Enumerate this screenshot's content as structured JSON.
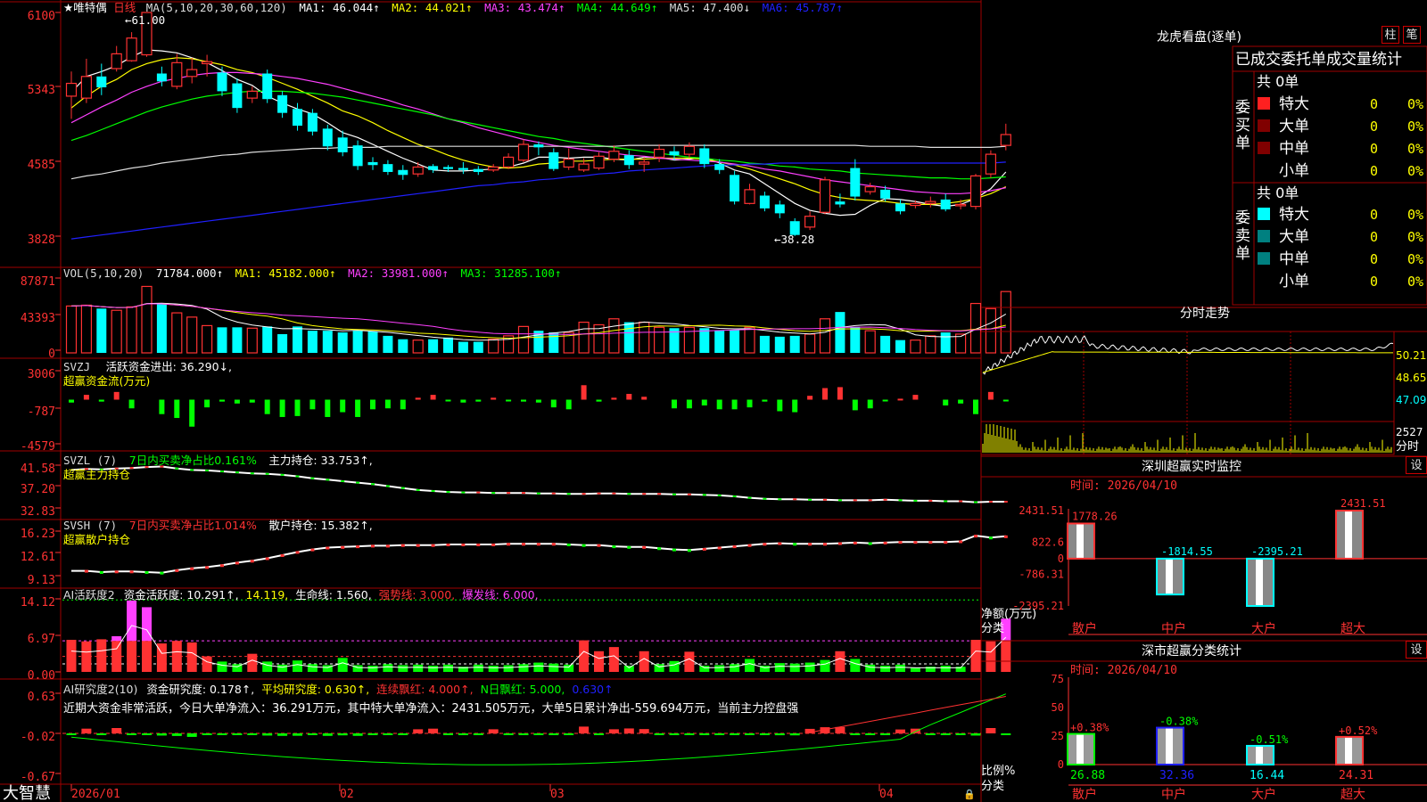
{
  "app": {
    "brand": "大智慧",
    "stock_title": "★唯特偶",
    "period": "日线"
  },
  "colors": {
    "up": "#ff3232",
    "down": "#00ffff",
    "green": "#00ff00",
    "grid": "#a00000",
    "yellow": "#ffff00",
    "magenta": "#ff40ff",
    "white": "#ffffff",
    "blue": "#2020ff"
  },
  "kline": {
    "axis_ticks": [
      "6100",
      "5343",
      "4585",
      "3828"
    ],
    "legend": {
      "ma": "MA(5,10,20,30,60,120)",
      "ma1": "MA1: 46.044↑",
      "ma2": "MA2: 44.021↑",
      "ma3": "MA3: 43.474↑",
      "ma4": "MA4: 44.649↑",
      "ma5": "MA5: 47.400↓",
      "ma6": "MA6: 45.787↑"
    },
    "high_label": "61.00",
    "low_label": "38.28",
    "candles": [
      [
        52.5,
        53.8,
        50.2,
        55.0
      ],
      [
        52.3,
        54.5,
        51.8,
        56.3
      ],
      [
        54.5,
        53.4,
        52.6,
        55.8
      ],
      [
        55.3,
        56.8,
        55.0,
        57.6
      ],
      [
        56.1,
        58.4,
        56.0,
        59.0
      ],
      [
        56.7,
        61.0,
        56.5,
        61.0
      ],
      [
        54.8,
        54.0,
        53.5,
        55.5
      ],
      [
        53.5,
        55.9,
        53.2,
        56.8
      ],
      [
        54.5,
        55.2,
        53.8,
        56.4
      ],
      [
        55.8,
        56.0,
        54.5,
        56.7
      ],
      [
        54.9,
        53.0,
        52.5,
        55.5
      ],
      [
        53.8,
        51.3,
        50.8,
        54.3
      ],
      [
        52.3,
        53.0,
        51.8,
        53.5
      ],
      [
        54.8,
        52.2,
        51.8,
        55.2
      ],
      [
        52.6,
        50.8,
        50.3,
        53.0
      ],
      [
        51.2,
        49.5,
        49.0,
        51.8
      ],
      [
        50.8,
        48.9,
        48.5,
        51.2
      ],
      [
        49.2,
        47.4,
        47.0,
        49.6
      ],
      [
        48.3,
        46.8,
        46.4,
        49.0
      ],
      [
        47.5,
        45.4,
        45.0,
        48.0
      ],
      [
        45.8,
        45.5,
        45.0,
        46.3
      ],
      [
        45.6,
        44.8,
        44.5,
        46.0
      ],
      [
        45.0,
        44.5,
        44.0,
        45.5
      ],
      [
        44.6,
        45.3,
        44.3,
        45.8
      ],
      [
        45.4,
        45.0,
        44.7,
        45.6
      ],
      [
        45.3,
        45.1,
        44.8,
        45.5
      ],
      [
        45.2,
        45.0,
        44.6,
        45.8
      ],
      [
        45.1,
        44.8,
        44.5,
        45.4
      ],
      [
        45.0,
        45.3,
        44.8,
        45.6
      ],
      [
        45.3,
        46.3,
        45.1,
        46.7
      ],
      [
        46.0,
        47.6,
        45.8,
        48.1
      ],
      [
        47.6,
        47.3,
        46.5,
        47.9
      ],
      [
        46.8,
        45.1,
        44.9,
        47.2
      ],
      [
        45.3,
        46.1,
        45.0,
        47.2
      ],
      [
        45.0,
        45.6,
        44.8,
        46.2
      ],
      [
        45.2,
        46.4,
        45.0,
        46.8
      ],
      [
        46.1,
        46.9,
        45.8,
        47.5
      ],
      [
        46.5,
        45.5,
        45.1,
        47.0
      ],
      [
        45.6,
        45.8,
        44.8,
        46.3
      ],
      [
        46.3,
        47.1,
        45.8,
        47.6
      ],
      [
        46.9,
        46.5,
        46.0,
        47.4
      ],
      [
        46.6,
        47.4,
        46.2,
        47.8
      ],
      [
        47.2,
        45.6,
        45.2,
        47.6
      ],
      [
        45.6,
        45.0,
        44.6,
        46.1
      ],
      [
        44.5,
        41.8,
        41.5,
        44.9
      ],
      [
        41.6,
        43.0,
        41.5,
        43.6
      ],
      [
        42.4,
        41.1,
        40.8,
        42.8
      ],
      [
        41.5,
        40.6,
        40.1,
        41.9
      ],
      [
        39.8,
        38.4,
        38.3,
        40.1
      ],
      [
        39.2,
        40.3,
        38.9,
        40.8
      ],
      [
        40.7,
        44.0,
        40.5,
        44.3
      ],
      [
        41.8,
        41.5,
        41.2,
        42.6
      ],
      [
        45.2,
        42.3,
        41.9,
        46.1
      ],
      [
        42.8,
        43.3,
        42.5,
        43.7
      ],
      [
        43.0,
        42.1,
        41.8,
        43.4
      ],
      [
        41.6,
        40.8,
        40.5,
        42.0
      ],
      [
        41.4,
        41.6,
        41.1,
        41.9
      ],
      [
        41.6,
        41.8,
        41.2,
        42.3
      ],
      [
        42.0,
        41.0,
        40.8,
        42.6
      ],
      [
        41.4,
        41.5,
        41.0,
        42.0
      ],
      [
        41.3,
        44.4,
        41.0,
        44.6
      ],
      [
        44.6,
        46.6,
        44.2,
        47.0
      ],
      [
        47.5,
        48.6,
        47.0,
        49.7
      ]
    ],
    "ma_lines": [
      {
        "color": "#ffffff",
        "values": [
          52.9,
          54.5,
          55.0,
          55.6,
          56.5,
          57.2,
          57.1,
          56.9,
          56.4,
          55.9,
          55.1,
          54.2,
          53.6,
          52.5,
          51.8,
          51.2,
          50.7,
          49.8,
          48.8,
          48.3,
          47.6,
          46.9,
          46.2,
          45.6,
          45.0,
          44.9,
          44.9,
          45.0,
          45.1,
          45.3,
          45.7,
          46.3,
          46.3,
          46.2,
          46.3,
          46.3,
          46.1,
          46.0,
          46.3,
          46.3,
          46.0,
          46.1,
          46.3,
          45.7,
          45.0,
          44.6,
          43.6,
          42.6,
          41.6,
          40.9,
          40.6,
          40.4,
          40.5,
          41.4,
          42.1,
          42.0,
          41.8,
          41.5,
          41.3,
          41.5,
          42.1,
          43.1,
          44.8
        ]
      },
      {
        "color": "#ffff00",
        "values": [
          51.3,
          52.5,
          53.5,
          54.2,
          55.2,
          55.8,
          56.2,
          56.4,
          56.3,
          56.0,
          55.7,
          55.2,
          54.9,
          54.4,
          53.8,
          53.2,
          52.5,
          51.8,
          51.0,
          50.5,
          49.8,
          49.0,
          48.3,
          47.6,
          47.1,
          46.5,
          46.0,
          45.6,
          45.3,
          45.2,
          45.3,
          45.6,
          45.7,
          45.9,
          45.9,
          46.0,
          46.1,
          46.1,
          46.1,
          46.2,
          46.2,
          46.2,
          46.1,
          45.8,
          45.5,
          45.1,
          44.6,
          44.1,
          43.6,
          43.0,
          42.5,
          42.2,
          42.0,
          41.9,
          41.8,
          41.6,
          41.5,
          41.5,
          41.6,
          41.8,
          42.1,
          42.6,
          43.3
        ]
      },
      {
        "color": "#ff40ff",
        "values": [
          49.8,
          50.6,
          51.4,
          52.1,
          52.9,
          53.5,
          54.0,
          54.3,
          54.6,
          54.8,
          54.9,
          54.9,
          54.8,
          54.7,
          54.5,
          54.3,
          54.0,
          53.7,
          53.3,
          52.9,
          52.5,
          52.1,
          51.6,
          51.2,
          50.7,
          50.2,
          49.8,
          49.3,
          48.9,
          48.5,
          48.1,
          47.8,
          47.5,
          47.3,
          47.1,
          46.9,
          46.7,
          46.5,
          46.4,
          46.2,
          46.1,
          46.0,
          45.9,
          45.8,
          45.6,
          45.4,
          45.1,
          44.9,
          44.6,
          44.3,
          44.0,
          43.8,
          43.6,
          43.4,
          43.2,
          43.0,
          42.8,
          42.7,
          42.6,
          42.6,
          42.7,
          42.9,
          43.2
        ]
      },
      {
        "color": "#00ff00",
        "values": [
          48.0,
          48.5,
          49.1,
          49.7,
          50.3,
          50.9,
          51.4,
          51.8,
          52.2,
          52.5,
          52.7,
          52.9,
          53.0,
          53.0,
          53.0,
          52.9,
          52.8,
          52.6,
          52.4,
          52.1,
          51.8,
          51.5,
          51.2,
          50.9,
          50.6,
          50.2,
          49.9,
          49.6,
          49.3,
          49.0,
          48.7,
          48.4,
          48.2,
          47.9,
          47.7,
          47.5,
          47.3,
          47.1,
          46.9,
          46.7,
          46.5,
          46.3,
          46.2,
          46.0,
          45.9,
          45.7,
          45.6,
          45.4,
          45.3,
          45.1,
          45.0,
          44.9,
          44.7,
          44.6,
          44.5,
          44.4,
          44.3,
          44.2,
          44.2,
          44.1,
          44.1,
          44.2,
          44.3
        ]
      },
      {
        "color": "#dddddd",
        "values": [
          44.1,
          44.4,
          44.6,
          44.9,
          45.2,
          45.4,
          45.7,
          45.9,
          46.1,
          46.3,
          46.5,
          46.6,
          46.8,
          46.9,
          47.0,
          47.1,
          47.2,
          47.2,
          47.3,
          47.3,
          47.3,
          47.4,
          47.4,
          47.4,
          47.4,
          47.4,
          47.4,
          47.4,
          47.4,
          47.4,
          47.4,
          47.4,
          47.4,
          47.4,
          47.4,
          47.4,
          47.4,
          47.5,
          47.5,
          47.5,
          47.5,
          47.5,
          47.5,
          47.5,
          47.5,
          47.5,
          47.5,
          47.5,
          47.5,
          47.5,
          47.5,
          47.5,
          47.5,
          47.4,
          47.4,
          47.4,
          47.4,
          47.3,
          47.3,
          47.3,
          47.3,
          47.3,
          47.4
        ]
      },
      {
        "color": "#2020ff",
        "values": [
          38.0,
          38.2,
          38.4,
          38.6,
          38.8,
          39.0,
          39.2,
          39.4,
          39.6,
          39.8,
          40.0,
          40.2,
          40.4,
          40.6,
          40.8,
          41.0,
          41.2,
          41.4,
          41.6,
          41.8,
          42.0,
          42.2,
          42.4,
          42.6,
          42.8,
          43.0,
          43.2,
          43.4,
          43.5,
          43.7,
          43.8,
          44.0,
          44.1,
          44.3,
          44.4,
          44.6,
          44.7,
          44.9,
          45.0,
          45.1,
          45.2,
          45.3,
          45.4,
          45.5,
          45.5,
          45.6,
          45.6,
          45.7,
          45.7,
          45.7,
          45.7,
          45.7,
          45.7,
          45.7,
          45.7,
          45.7,
          45.7,
          45.7,
          45.7,
          45.7,
          45.7,
          45.7,
          45.8
        ]
      }
    ]
  },
  "volume": {
    "axis_ticks": [
      "87871",
      "43393",
      "0"
    ],
    "legend": {
      "name": "VOL(5,10,20)",
      "value": "71784.000↑",
      "ma1": "MA1: 45182.000↑",
      "ma2": "MA2: 33981.000↑",
      "ma3": "MA3: 31285.100↑"
    },
    "values": [
      55000,
      56000,
      52000,
      50000,
      54000,
      78000,
      58000,
      47000,
      42000,
      32000,
      30000,
      30000,
      29000,
      31000,
      22000,
      31000,
      26000,
      26000,
      24000,
      26000,
      25000,
      20000,
      16000,
      15000,
      16000,
      18000,
      13000,
      13000,
      16000,
      20000,
      31000,
      26000,
      24000,
      24000,
      36000,
      33000,
      40000,
      36000,
      36000,
      30000,
      29000,
      30000,
      29000,
      26000,
      27000,
      30000,
      20000,
      19000,
      20000,
      22000,
      40000,
      48000,
      30000,
      26000,
      20000,
      15000,
      15000,
      20000,
      24000,
      22000,
      58000,
      52000,
      72000
    ]
  },
  "svzj": {
    "axis_ticks": [
      "3006",
      "-787",
      "-4579"
    ],
    "legend": {
      "name": "SVZJ",
      "label": "活跃资金进出: 36.290↓,",
      "sub": "超赢资金流(万元)"
    },
    "values": [
      -300,
      500,
      -200,
      800,
      -900,
      0,
      -1500,
      -1900,
      -2800,
      -800,
      -200,
      -400,
      -300,
      -1500,
      -1800,
      -1700,
      -1000,
      -1800,
      -1300,
      -1800,
      -1000,
      -900,
      -1000,
      200,
      500,
      -100,
      -300,
      -200,
      200,
      -100,
      -200,
      -300,
      -800,
      -1000,
      1500,
      -200,
      200,
      600,
      300,
      0,
      -900,
      -900,
      -600,
      -1000,
      -1000,
      -800,
      -200,
      -1200,
      -1300,
      400,
      1200,
      1300,
      -1100,
      -900,
      -100,
      100,
      500,
      0,
      -600,
      -400,
      -1500,
      800,
      -100
    ]
  },
  "svzl": {
    "axis_ticks": [
      "41.58",
      "37.20",
      "32.83"
    ],
    "legend": {
      "name": "SVZL (7)",
      "pct": "7日内买卖净占比0.161%",
      "label": "主力持仓: 33.753↑,",
      "sub": "超赢主力持仓"
    },
    "values": [
      40.6,
      40.8,
      40.7,
      40.9,
      41.0,
      41.2,
      41.3,
      40.9,
      40.6,
      40.5,
      40.3,
      40.1,
      39.9,
      39.8,
      39.6,
      39.3,
      38.9,
      38.6,
      38.3,
      38.0,
      37.7,
      37.3,
      36.9,
      36.5,
      36.3,
      36.1,
      36.0,
      36.0,
      35.9,
      35.9,
      35.9,
      35.8,
      35.8,
      35.7,
      35.7,
      35.8,
      35.8,
      35.7,
      35.7,
      35.7,
      35.6,
      35.6,
      35.5,
      35.4,
      35.2,
      34.9,
      34.7,
      34.6,
      34.6,
      34.5,
      34.5,
      34.4,
      34.4,
      34.4,
      34.5,
      34.4,
      34.3,
      34.3,
      34.2,
      34.2,
      34.0,
      34.1,
      34.1
    ]
  },
  "svsh": {
    "axis_ticks": [
      "16.23",
      "12.61",
      "9.13"
    ],
    "legend": {
      "name": "SVSH (7)",
      "pct": "7日内买卖净占比1.014%",
      "label": "散户持仓: 15.382↑,",
      "sub": "超赢散户持仓"
    },
    "values": [
      9.9,
      9.9,
      9.7,
      9.8,
      9.8,
      9.7,
      9.6,
      10.0,
      10.3,
      10.5,
      10.8,
      11.2,
      11.5,
      11.9,
      12.4,
      12.9,
      13.3,
      13.6,
      13.7,
      13.8,
      13.9,
      13.9,
      14.0,
      14.0,
      14.0,
      14.1,
      14.1,
      14.1,
      14.1,
      14.2,
      14.2,
      14.2,
      14.2,
      14.1,
      14.0,
      14.0,
      13.8,
      13.7,
      13.7,
      13.5,
      13.3,
      13.2,
      13.4,
      13.6,
      13.8,
      14.0,
      14.2,
      14.3,
      14.2,
      14.2,
      14.2,
      14.3,
      14.4,
      14.3,
      14.4,
      14.5,
      14.5,
      14.5,
      14.5,
      14.6,
      15.5,
      15.2,
      15.4
    ]
  },
  "ai_active": {
    "axis_ticks": [
      "14.12",
      "6.97",
      "0.00"
    ],
    "legend": {
      "name": "AI活跃度2",
      "label": "资金活跃度: 10.291↑,",
      "v2": "14.119,",
      "life": "生命线: 1.560,",
      "strong": "强势线: 3.000,",
      "burst": "爆发线: 6.000,"
    },
    "values": [
      6.2,
      5.9,
      6.3,
      6.9,
      13.8,
      12.5,
      5.5,
      6.0,
      5.7,
      3.0,
      2.0,
      1.5,
      3.5,
      2.0,
      1.4,
      2.2,
      1.5,
      1.3,
      2.7,
      1.3,
      1.2,
      1.5,
      1.3,
      1.4,
      1.2,
      1.4,
      1.0,
      1.4,
      1.2,
      1.3,
      1.5,
      1.8,
      1.6,
      1.4,
      6.1,
      4.0,
      4.8,
      1.2,
      4.0,
      1.5,
      2.1,
      3.9,
      1.2,
      1.3,
      1.5,
      2.5,
      1.2,
      1.7,
      1.6,
      1.8,
      2.3,
      4.0,
      2.5,
      1.4,
      1.2,
      1.4,
      0.8,
      1.0,
      1.2,
      1.0,
      6.2,
      5.9,
      10.3
    ]
  },
  "ai_research": {
    "axis_ticks": [
      "0.63",
      "-0.02",
      "-0.67"
    ],
    "legend": {
      "name": "AI研究度2(10)",
      "label": "资金研究度: 0.178↑,",
      "avg": "平均研究度: 0.630↑,",
      "lh": "连续飘红: 4.000↑,",
      "nd": "N日飘红: 5.000,",
      "extra": "0.630↑"
    },
    "comment": "近期大资金非常活跃，今日大单净流入：36.291万元，其中特大单净流入：2431.505万元，大单5日累计净出-559.694万元，当前主力控盘强"
  },
  "date_axis": [
    "2026/01",
    "02",
    "03",
    "04"
  ],
  "right": {
    "title": "龙虎看盘(逐单)",
    "btn1": "柱",
    "btn2": "笔",
    "tabs": "已成交委托单成交量统计",
    "buy": {
      "side": "委买单",
      "total": "共 0单",
      "rows": [
        {
          "label": "特大",
          "val": "0",
          "pct": "0%"
        },
        {
          "label": "大单",
          "val": "0",
          "pct": "0%"
        },
        {
          "label": "中单",
          "val": "0",
          "pct": "0%"
        },
        {
          "label": "小单",
          "val": "0",
          "pct": "0%"
        }
      ]
    },
    "sell": {
      "side": "委卖单",
      "total": "共 0单",
      "rows": [
        {
          "label": "特大",
          "val": "0",
          "pct": "0%"
        },
        {
          "label": "大单",
          "val": "0",
          "pct": "0%"
        },
        {
          "label": "中单",
          "val": "0",
          "pct": "0%"
        },
        {
          "label": "小单",
          "val": "0",
          "pct": "0%"
        }
      ]
    },
    "intraday": {
      "title": "分时走势",
      "ticks": [
        "50.21",
        "48.65",
        "47.09"
      ],
      "vol_tick": "2527",
      "vol_label": "分时"
    },
    "monitor": {
      "title": "深圳超赢实时监控",
      "set": "设",
      "time": "时间: 2026/04/10",
      "ticks": [
        "2431.51",
        "822.6",
        "0",
        "-786.31",
        "-2395.21"
      ],
      "ylabel1": "净额(万元)",
      "ylabel2": "分类",
      "categories": [
        "散户",
        "中户",
        "大户",
        "超大"
      ],
      "values": [
        1778.26,
        -1814.55,
        -2395.21,
        2431.51
      ],
      "value_labels": [
        "1778.26",
        "-1814.55",
        "-2395.21",
        "2431.51"
      ]
    },
    "classify": {
      "title": "深市超赢分类统计",
      "set": "设",
      "time": "时间: 2026/04/10",
      "ticks": [
        "75",
        "50",
        "25",
        "0"
      ],
      "ylabel1": "比例%",
      "ylabel2": "分类",
      "categories": [
        "散户",
        "中户",
        "大户",
        "超大"
      ],
      "values": [
        26.88,
        32.36,
        16.44,
        24.31
      ],
      "value_labels": [
        "26.88",
        "32.36",
        "16.44",
        "24.31"
      ],
      "changes": [
        "+0.38%",
        "-0.38%",
        "-0.51%",
        "+0.52%"
      ]
    }
  }
}
